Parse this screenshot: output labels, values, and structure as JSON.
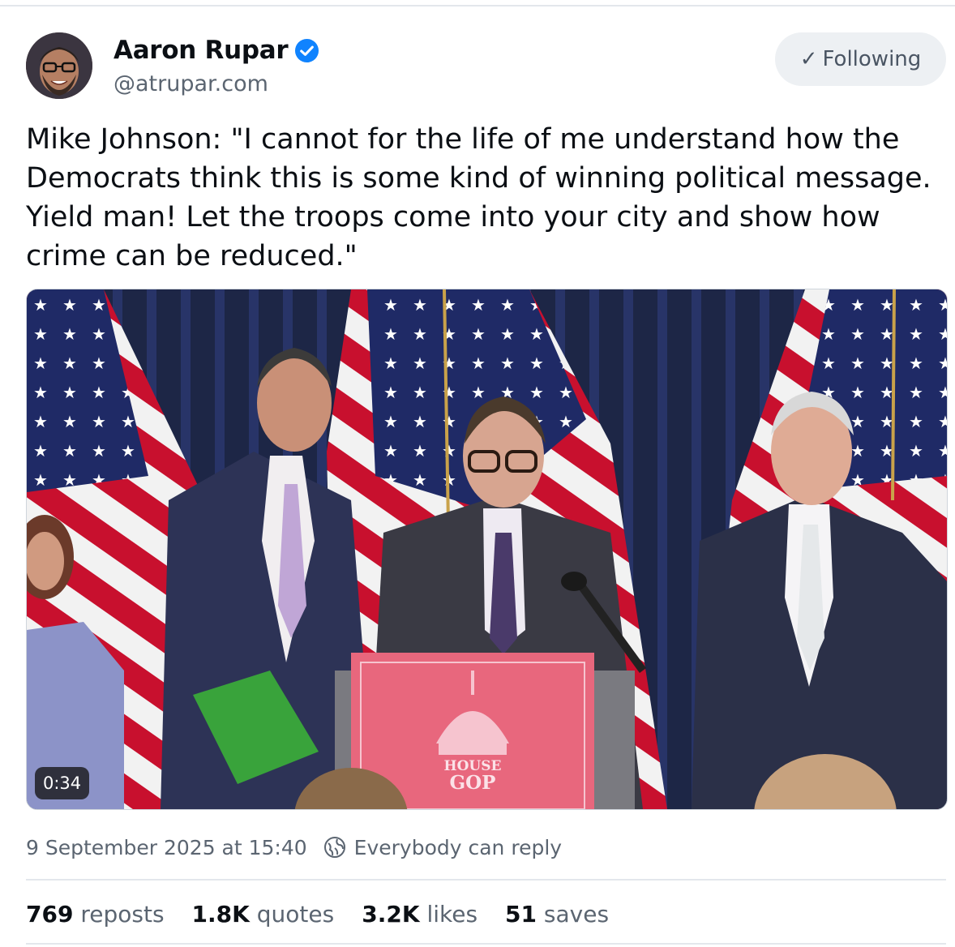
{
  "author": {
    "display_name": "Aaron Rupar",
    "handle": "@atrupar.com",
    "verified": true,
    "verified_color": "#1083fe"
  },
  "follow_button": {
    "icon": "checkmark-icon",
    "label": "Following"
  },
  "post": {
    "text": "Mike Johnson: \"I cannot for the life of me understand how the Democrats think this is some kind of winning political message. Yield man! Let the troops come into your city and show how crime can be reduced.\""
  },
  "media": {
    "duration": "0:34",
    "podium_sign": {
      "line1": "HOUSE",
      "line2": "GOP"
    }
  },
  "meta": {
    "timestamp": "9 September 2025 at 15:40",
    "reply_setting": "Everybody can reply"
  },
  "stats": {
    "reposts_count": "769",
    "reposts_label": "reposts",
    "quotes_count": "1.8K",
    "quotes_label": "quotes",
    "likes_count": "3.2K",
    "likes_label": "likes",
    "saves_count": "51",
    "saves_label": "saves"
  },
  "colors": {
    "text_primary": "#0b0f14",
    "text_secondary": "#5b6571",
    "button_bg": "#edf0f3",
    "divider": "#e3e7ec"
  }
}
